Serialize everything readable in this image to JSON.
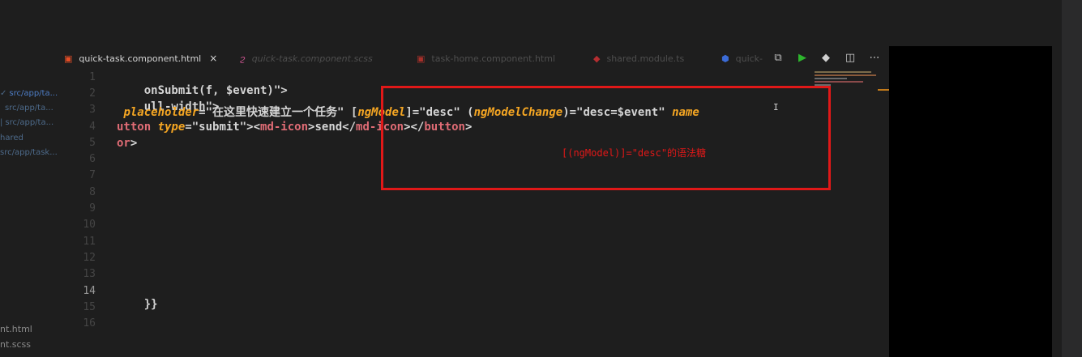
{
  "sidebar": {
    "paths": [
      {
        "text": "src/app/ta...",
        "color": "#4d7cc4",
        "mark": "✓"
      },
      {
        "text": "src/app/ta...",
        "color": "#4d6a8a",
        "mark": ""
      },
      {
        "text": "src/app/ta...",
        "color": "#4d6a8a",
        "mark": "|"
      },
      {
        "text": "hared",
        "color": "#4d6a8a",
        "mark": ""
      },
      {
        "text": "src/app/task...",
        "color": "#4d6a8a",
        "mark": ""
      }
    ],
    "files": [
      "nt.html",
      "nt.scss"
    ]
  },
  "tabs": [
    {
      "label": "quick-task.component.html",
      "icon": "html5-icon",
      "glyph": "▣",
      "icon_color": "#e44d26",
      "active": true,
      "close": "×"
    },
    {
      "label": "quick-task.component.scss",
      "icon": "sass-icon",
      "glyph": "ϩ",
      "icon_color": "#c6538c",
      "active": false
    },
    {
      "label": "task-home.component.html",
      "icon": "html5-icon",
      "glyph": "▣",
      "icon_color": "#a8302a",
      "active": false
    },
    {
      "label": "shared.module.ts",
      "icon": "angular-icon",
      "glyph": "◆",
      "icon_color": "#b52e31",
      "active": false
    },
    {
      "label": "quick-",
      "icon": "angular-icon",
      "glyph": "⬢",
      "icon_color": "#3b6bd6",
      "active": false
    }
  ],
  "toolbar": {
    "icons": [
      "compare-icon",
      "run-icon",
      "git-icon",
      "split-editor-icon",
      "more-icon"
    ],
    "glyphs": [
      "⧉",
      "▶",
      "◆",
      "◫",
      "⋯"
    ],
    "colors": [
      "#bbbbbb",
      "#2db52d",
      "#d0d0d0",
      "#d0d0d0",
      "#d0d0d0"
    ]
  },
  "editor": {
    "line_numbers": [
      "1",
      "2",
      "3",
      "4",
      "5",
      "6",
      "7",
      "8",
      "9",
      "10",
      "11",
      "12",
      "13",
      "14",
      "15",
      "16"
    ],
    "current_line": "14",
    "lines": {
      "l1": {
        "a": "onSubmit(f, $event)\">"
      },
      "l2": {
        "a": "ull-width\">"
      },
      "l3": {
        "a": " ",
        "b": "placeholder",
        "c": "=\"在这里快速建立一个任务\" ",
        "d": "[",
        "e": "ngModel",
        "f": "]=\"desc\" (",
        "g": "ngModelChange",
        "h": ")=\"desc=$event\" ",
        "i": "name"
      },
      "l4": {
        "a": "utton ",
        "b": "type",
        "c": "=\"submit\"><",
        "d": "md-icon",
        "e": ">send</",
        "f": "md-icon",
        "g": "></",
        "h": "button",
        "i": ">"
      },
      "l5": {
        "a": "or",
        "b": ">"
      },
      "l14": {
        "a": "}}"
      }
    }
  },
  "annotation": {
    "text": "[(ngModel)]=\"desc\"的语法糖",
    "color": "#e01818"
  }
}
